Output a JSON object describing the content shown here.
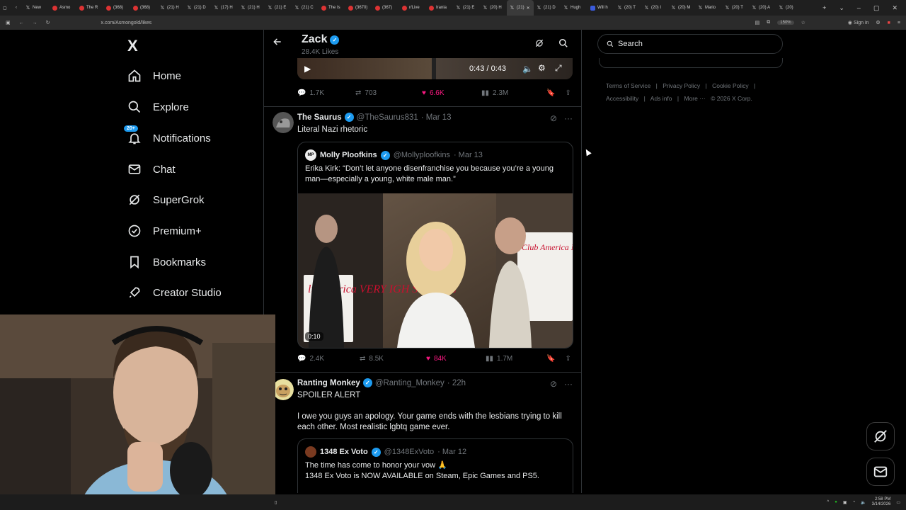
{
  "browser": {
    "tabs": [
      {
        "label": "New",
        "icon": "x"
      },
      {
        "label": "Asmo",
        "icon": "red"
      },
      {
        "label": "The R",
        "icon": "red"
      },
      {
        "label": "(368)",
        "icon": "red"
      },
      {
        "label": "(368)",
        "icon": "red"
      },
      {
        "label": "(21) H",
        "icon": "x"
      },
      {
        "label": "(21) D",
        "icon": "x"
      },
      {
        "label": "(17) H",
        "icon": "x"
      },
      {
        "label": "(21) H",
        "icon": "x"
      },
      {
        "label": "(21) E",
        "icon": "x"
      },
      {
        "label": "(21) C",
        "icon": "x"
      },
      {
        "label": "The Is",
        "icon": "red"
      },
      {
        "label": "(3670)",
        "icon": "red"
      },
      {
        "label": "(367)",
        "icon": "red"
      },
      {
        "label": "r/Live",
        "icon": "red"
      },
      {
        "label": "Irania",
        "icon": "red"
      },
      {
        "label": "(21) E",
        "icon": "x"
      },
      {
        "label": "(20) H",
        "icon": "x"
      },
      {
        "label": "(21)",
        "icon": "x",
        "active": true
      },
      {
        "label": "(21) D",
        "icon": "x"
      },
      {
        "label": "Hugh",
        "icon": "x"
      },
      {
        "label": "Will h",
        "icon": "blue"
      },
      {
        "label": "(20) T",
        "icon": "x"
      },
      {
        "label": "(20) I",
        "icon": "x"
      },
      {
        "label": "(20) M",
        "icon": "x"
      },
      {
        "label": "Mario",
        "icon": "x"
      },
      {
        "label": "(20) T",
        "icon": "x"
      },
      {
        "label": "(20) A",
        "icon": "x"
      },
      {
        "label": "(20)",
        "icon": "x"
      }
    ],
    "url": "x.com/Asmongold/likes",
    "zoom": "150%",
    "sign_in": "Sign in"
  },
  "nav": {
    "logo": "X",
    "items": [
      {
        "label": "Home",
        "icon": "home-icon"
      },
      {
        "label": "Explore",
        "icon": "search-icon"
      },
      {
        "label": "Notifications",
        "icon": "bell-icon",
        "badge": "20+"
      },
      {
        "label": "Chat",
        "icon": "mail-icon"
      },
      {
        "label": "SuperGrok",
        "icon": "grok-icon"
      },
      {
        "label": "Premium+",
        "icon": "verified-icon"
      },
      {
        "label": "Bookmarks",
        "icon": "bookmark-icon"
      },
      {
        "label": "Creator Studio",
        "icon": "rocket-icon"
      }
    ]
  },
  "header": {
    "title": "Zack",
    "subtitle": "28.4K Likes"
  },
  "post0": {
    "video_time": "0:43 / 0:43",
    "replies": "1.7K",
    "reposts": "703",
    "likes": "6.6K",
    "views": "2.3M"
  },
  "post1": {
    "name": "The Saurus",
    "handle": "@TheSaurus831",
    "date": "· Mar 13",
    "text": "Literal Nazi rhetoric",
    "quote": {
      "avatar_text": "MP",
      "name": "Molly Ploofkins",
      "handle": "@Mollyploofkins",
      "date": "· Mar 13",
      "text": "Erika Kirk: “Don’t let anyone disenfranchise you because you’re a young man—especially a young, white male man.”",
      "duration": "0:10",
      "sign_left": "lub merica VERY IGH SCHOOL",
      "sign_right": "Club America N EVER S HI"
    },
    "replies": "2.4K",
    "reposts": "8.5K",
    "likes": "84K",
    "views": "1.7M"
  },
  "post2": {
    "name": "Ranting Monkey",
    "handle": "@Ranting_Monkey",
    "date": "· 22h",
    "text1": "SPOILER ALERT",
    "text2": "I owe you guys an apology. Your game ends with the lesbians trying to kill each other. Most realistic lgbtq game ever.",
    "quote": {
      "name": "1348 Ex Voto",
      "handle": "@1348ExVoto",
      "date": "· Mar 12",
      "line1": "The time has come to honor your vow 🙏",
      "line2": "1348 Ex Voto is NOW AVAILABLE on Steam, Epic Games and PS5."
    }
  },
  "sidebar": {
    "search_placeholder": "Search",
    "footer": [
      "Terms of Service",
      "|",
      "Privacy Policy",
      "|",
      "Cookie Policy",
      "|",
      "Accessibility",
      "|",
      "Ads info",
      "|",
      "More ···",
      "© 2026 X Corp."
    ]
  },
  "taskbar": {
    "time": "2:58 PM",
    "date": "3/14/2026"
  },
  "colors": {
    "accent": "#1d9bf0",
    "like": "#f91880",
    "muted": "#71767b",
    "border": "#2f3336"
  }
}
